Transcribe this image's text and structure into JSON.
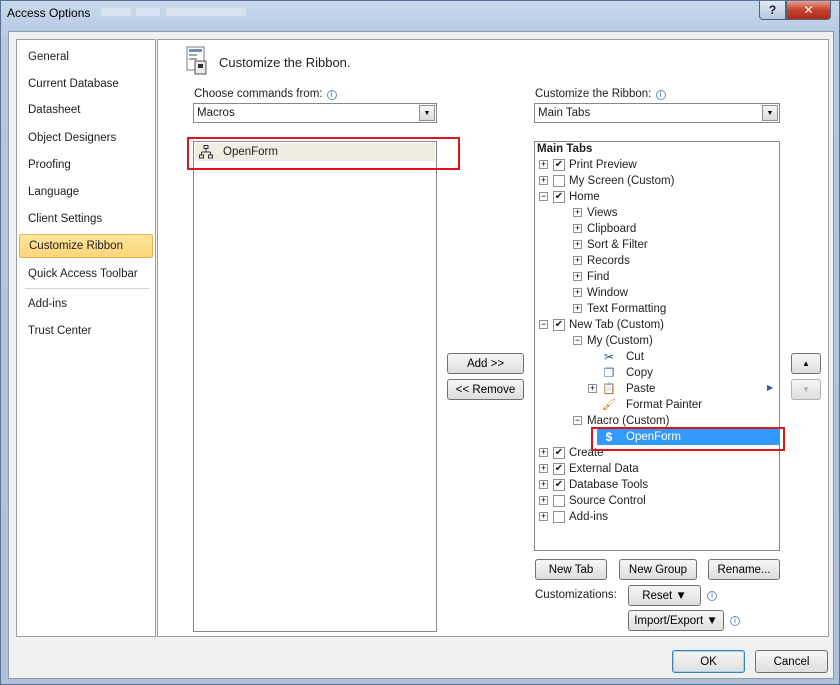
{
  "window": {
    "title": "Access Options",
    "help_label": "?",
    "close_label": "✕"
  },
  "nav": {
    "items": [
      {
        "label": "General"
      },
      {
        "label": "Current Database"
      },
      {
        "label": "Datasheet"
      },
      {
        "label": "Object Designers"
      },
      {
        "label": "Proofing"
      },
      {
        "label": "Language"
      },
      {
        "label": "Client Settings"
      },
      {
        "label": "Customize Ribbon"
      },
      {
        "label": "Quick Access Toolbar"
      },
      {
        "label": "Add-ins"
      },
      {
        "label": "Trust Center"
      }
    ],
    "selected": "Customize Ribbon"
  },
  "page": {
    "title": "Customize the Ribbon."
  },
  "commands": {
    "label": "Choose commands from:",
    "value": "Macros",
    "items": [
      {
        "label": "OpenForm",
        "icon": "macro-icon"
      }
    ]
  },
  "ribbon": {
    "label": "Customize the Ribbon:",
    "value": "Main Tabs",
    "tree_header": "Main Tabs",
    "tree": [
      {
        "label": "Print Preview",
        "expander": "+",
        "checked": "✔"
      },
      {
        "label": "My Screen (Custom)",
        "expander": "+",
        "checked": ""
      },
      {
        "label": "Home",
        "expander": "−",
        "checked": "✔"
      },
      {
        "label": "Views",
        "expander": "+"
      },
      {
        "label": "Clipboard",
        "expander": "+"
      },
      {
        "label": "Sort & Filter",
        "expander": "+"
      },
      {
        "label": "Records",
        "expander": "+"
      },
      {
        "label": "Find",
        "expander": "+"
      },
      {
        "label": "Window",
        "expander": "+"
      },
      {
        "label": "Text Formatting",
        "expander": "+"
      },
      {
        "label": "New Tab (Custom)",
        "expander": "−",
        "checked": "✔"
      },
      {
        "label": "My (Custom)",
        "expander": "−"
      },
      {
        "label": "Cut",
        "icon": "scissors-icon",
        "glyph": "✂"
      },
      {
        "label": "Copy",
        "icon": "copy-icon",
        "glyph": "❐"
      },
      {
        "label": "Paste",
        "icon": "paste-icon",
        "glyph": "📋",
        "expander": "+"
      },
      {
        "label": "Format Painter",
        "icon": "format-painter-icon",
        "glyph": "🖌"
      },
      {
        "label": "Macro (Custom)",
        "expander": "−"
      },
      {
        "label": "OpenForm",
        "icon": "macro-icon",
        "glyph": "$"
      },
      {
        "label": "Create",
        "expander": "+",
        "checked": "✔"
      },
      {
        "label": "External Data",
        "expander": "+",
        "checked": "✔"
      },
      {
        "label": "Database Tools",
        "expander": "+",
        "checked": "✔"
      },
      {
        "label": "Source Control",
        "expander": "+",
        "checked": ""
      },
      {
        "label": "Add-ins",
        "expander": "+",
        "checked": ""
      }
    ]
  },
  "buttons": {
    "add": "Add >>",
    "remove": "<< Remove",
    "move_up": "▲",
    "move_down": "▼",
    "expand_arrow": "▶",
    "new_tab": "New Tab",
    "new_group": "New Group",
    "rename": "Rename...",
    "customizations_label": "Customizations:",
    "reset": "Reset ▼",
    "import_export": "Import/Export ▼",
    "ok": "OK",
    "cancel": "Cancel",
    "info": "i",
    "combo_arrow": "▼"
  }
}
